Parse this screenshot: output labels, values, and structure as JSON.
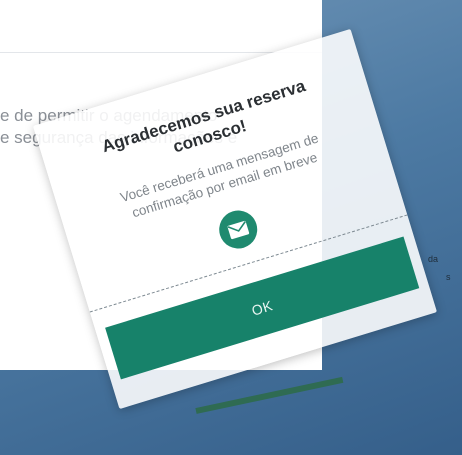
{
  "background": {
    "line1": "e de permitir o agendamento",
    "line2": "e segurança das informações e",
    "right_snippet_1": "da",
    "right_snippet_2": "s"
  },
  "modal": {
    "title_line1": "Agradecemos sua reserva",
    "title_line2": "conosco!",
    "subtitle_line1": "Você receberá uma mensagem de",
    "subtitle_line2": "confirmação por email em breve",
    "ok_label": "OK"
  },
  "colors": {
    "accent": "#17826a",
    "icon_circle": "#1f8a6f"
  },
  "icons": {
    "mail": "mail-icon"
  }
}
